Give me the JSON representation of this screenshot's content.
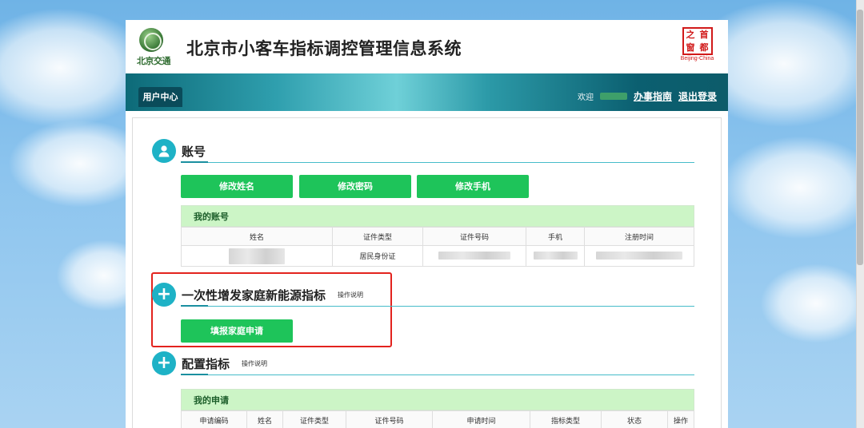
{
  "header": {
    "logo_text": "北京交通",
    "system_title": "北京市小客车指标调控管理信息系统",
    "capital_logo": {
      "chars": [
        "之",
        "首",
        "窗",
        "都"
      ],
      "sub": "Beijing-China"
    }
  },
  "banner": {
    "tab": "用户中心",
    "welcome": "欢迎",
    "guide_link": "办事指南",
    "logout_link": "退出登录"
  },
  "account": {
    "title": "账号",
    "buttons": [
      "修改姓名",
      "修改密码",
      "修改手机"
    ],
    "table_caption": "我的账号",
    "columns": [
      "姓名",
      "证件类型",
      "证件号码",
      "手机",
      "注册时间"
    ],
    "row": {
      "id_type": "居民身份证"
    }
  },
  "one_time": {
    "title": "一次性增发家庭新能源指标",
    "help": "操作说明",
    "apply_button": "填报家庭申请"
  },
  "allocation": {
    "title": "配置指标",
    "help": "操作说明",
    "table_caption": "我的申请",
    "columns": [
      "申请编码",
      "姓名",
      "证件类型",
      "证件号码",
      "申请时间",
      "指标类型",
      "状态",
      "操作"
    ]
  },
  "colors": {
    "accent_teal": "#1eb2c6",
    "button_green": "#1ec45a",
    "table_caption_bg": "#ccf5c6",
    "highlight_red": "#e3231e"
  },
  "icons": {
    "account_section": "user-icon",
    "add_sections": "plus-icon"
  }
}
